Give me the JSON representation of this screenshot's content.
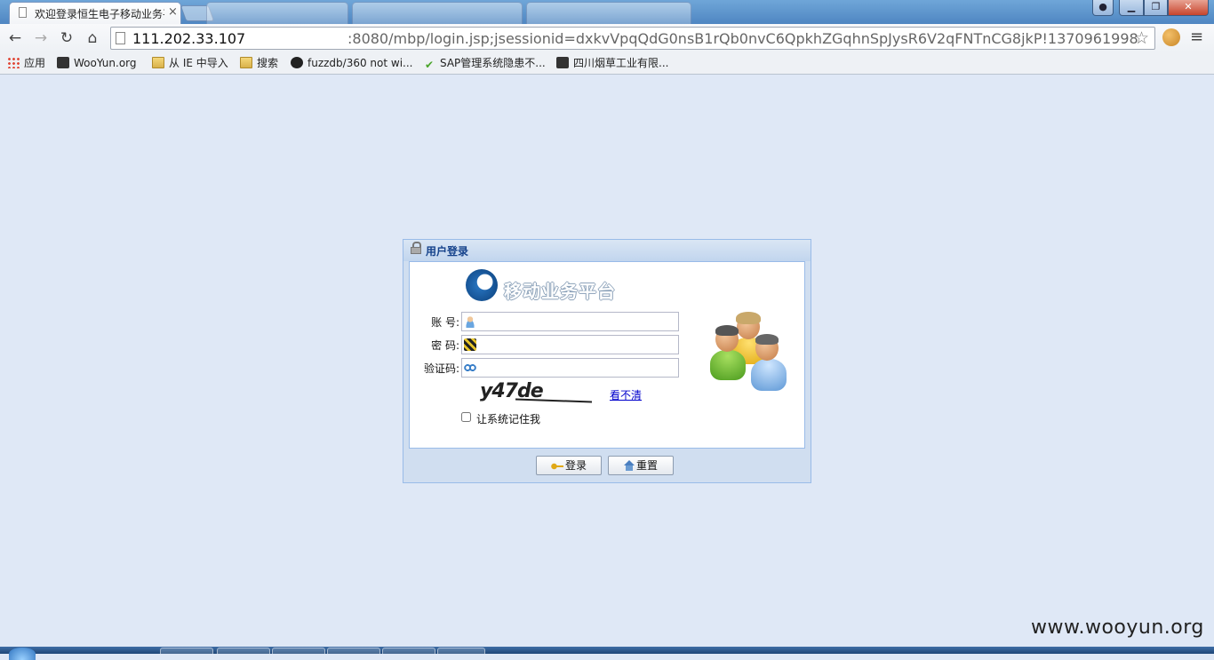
{
  "browser": {
    "tab_title": "欢迎登录恒生电子移动业务平台",
    "tab_close": "×",
    "url_host": "111.202.33.107",
    "url_path": ":8080/mbp/login.jsp;jsessionid=dxkvVpqQdG0nsB1rQb0nvC6QpkhZGqhnSpJysR6V2qFNTnCG8jkP!1370961998",
    "window_buttons": {
      "minimize": "▁",
      "maximize": "❐",
      "close": "✕"
    },
    "nav_icons": {
      "back": "←",
      "forward": "→",
      "reload": "↻",
      "home": "⌂",
      "star": "☆",
      "menu": "≡"
    }
  },
  "bookmarks": [
    {
      "label": "应用",
      "icon": "apps-grid-icon"
    },
    {
      "label": "WooYun.org",
      "icon": "wooyun-icon"
    },
    {
      "label": "从 IE 中导入",
      "icon": "folder-icon"
    },
    {
      "label": "搜索",
      "icon": "folder-icon"
    },
    {
      "label": "fuzzdb/360 not wi...",
      "icon": "github-icon"
    },
    {
      "label": "SAP管理系统隐患不...",
      "icon": "check-icon"
    },
    {
      "label": "四川烟草工业有限...",
      "icon": "site-icon"
    }
  ],
  "login": {
    "panel_title": "用户登录",
    "logo_text": "移动业务平台",
    "account_label": "账 号:",
    "password_label": "密 码:",
    "captcha_label": "验证码:",
    "account_value": "",
    "password_value": "",
    "captcha_value": "",
    "captcha_image_text": "y47de",
    "refresh_link": "看不清",
    "remember_label": "让系统记住我",
    "remember_checked": false,
    "login_button": "登录",
    "reset_button": "重置"
  },
  "watermark": "www.wooyun.org",
  "colors": {
    "page_background": "#dfe8f6",
    "panel_header_text": "#15428b",
    "panel_border": "#99bbe8",
    "link": "#0000cc"
  }
}
